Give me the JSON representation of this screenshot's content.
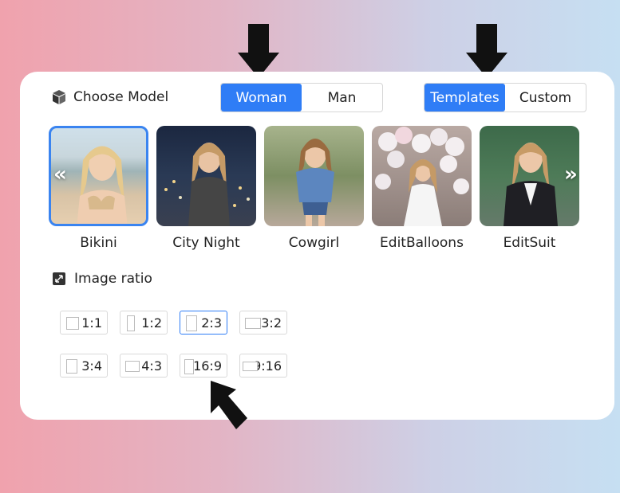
{
  "header": {
    "model_label": "Choose Model",
    "gender_options": [
      "Woman",
      "Man"
    ],
    "mode_options": [
      "Templates",
      "Custom"
    ]
  },
  "templates": [
    {
      "name": "Bikini",
      "selected": true
    },
    {
      "name": "City Night",
      "selected": false
    },
    {
      "name": "Cowgirl",
      "selected": false
    },
    {
      "name": "EditBalloons",
      "selected": false
    },
    {
      "name": "EditSuit",
      "selected": false
    }
  ],
  "nav": {
    "prev": "«",
    "next": "»"
  },
  "ratio": {
    "label": "Image ratio",
    "options": [
      "1:1",
      "1:2",
      "2:3",
      "3:2",
      "3:4",
      "4:3",
      "16:9",
      "9:16"
    ],
    "selected": "2:3"
  },
  "colors": {
    "accent": "#2f7df6"
  }
}
